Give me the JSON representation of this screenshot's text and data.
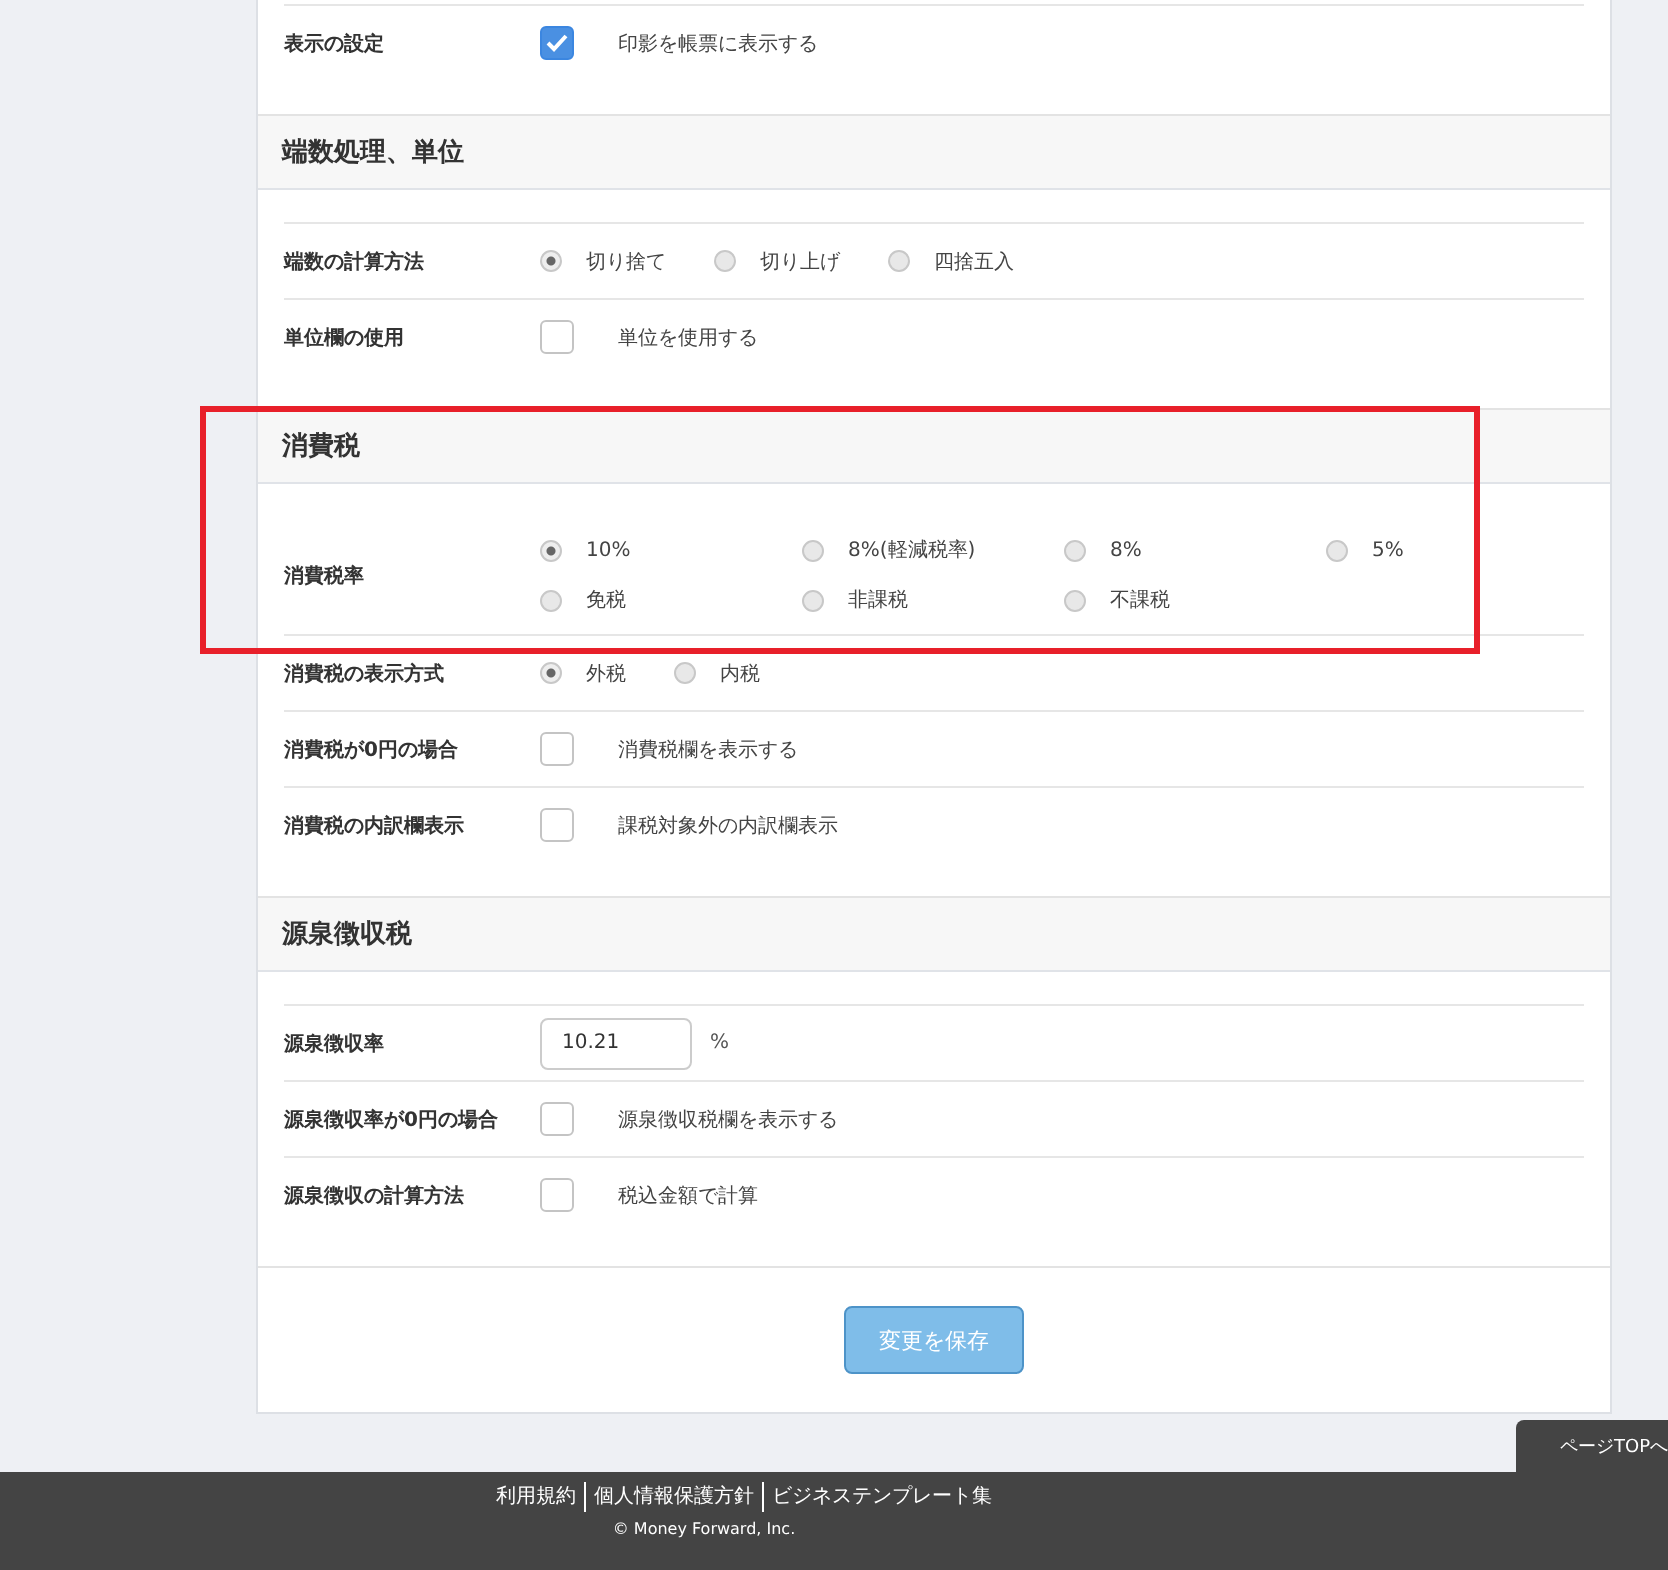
{
  "sections": [
    {
      "highlighted": false,
      "rows": [
        {
          "kind": "checkbox",
          "label": "表示の設定",
          "options": [
            {
              "text": "印影を帳票に表示する",
              "checked": true
            }
          ]
        }
      ]
    },
    {
      "title": "端数処理、単位",
      "highlighted": false,
      "rows": [
        {
          "kind": "radio",
          "label": "端数の計算方法",
          "options": [
            {
              "text": "切り捨て",
              "selected": true
            },
            {
              "text": "切り上げ",
              "selected": false
            },
            {
              "text": "四捨五入",
              "selected": false
            }
          ]
        },
        {
          "kind": "checkbox",
          "label": "単位欄の使用",
          "options": [
            {
              "text": "単位を使用する",
              "checked": false
            }
          ]
        }
      ]
    },
    {
      "title": "消費税",
      "highlighted": true,
      "rows": [
        {
          "kind": "radio-grid",
          "label": "消費税率",
          "options": [
            {
              "text": "10%",
              "selected": true
            },
            {
              "text": "8%(軽減税率)",
              "selected": false
            },
            {
              "text": "8%",
              "selected": false
            },
            {
              "text": "5%",
              "selected": false
            },
            {
              "text": "免税",
              "selected": false
            },
            {
              "text": "非課税",
              "selected": false
            },
            {
              "text": "不課税",
              "selected": false
            }
          ]
        },
        {
          "kind": "radio",
          "label": "消費税の表示方式",
          "options": [
            {
              "text": "外税",
              "selected": true
            },
            {
              "text": "内税",
              "selected": false
            }
          ]
        },
        {
          "kind": "checkbox",
          "label": "消費税が0円の場合",
          "options": [
            {
              "text": "消費税欄を表示する",
              "checked": false
            }
          ]
        },
        {
          "kind": "checkbox",
          "label": "消費税の内訳欄表示",
          "options": [
            {
              "text": "課税対象外の内訳欄表示",
              "checked": false
            }
          ]
        }
      ]
    },
    {
      "title": "源泉徴収税",
      "highlighted": false,
      "rows": [
        {
          "kind": "input",
          "label": "源泉徴収率",
          "value": "10.21",
          "unit": "%"
        },
        {
          "kind": "checkbox",
          "label": "源泉徴収率が0円の場合",
          "options": [
            {
              "text": "源泉徴収税欄を表示する",
              "checked": false
            }
          ]
        },
        {
          "kind": "checkbox",
          "label": "源泉徴収の計算方法",
          "options": [
            {
              "text": "税込金額で計算",
              "checked": false
            }
          ]
        }
      ]
    }
  ],
  "save_button": "変更を保存",
  "page_top": "ページTOPへ",
  "footer": {
    "links": [
      "利用規約",
      "個人情報保護方針",
      "ビジネステンプレート集"
    ],
    "copyright": "© Money Forward, Inc."
  }
}
